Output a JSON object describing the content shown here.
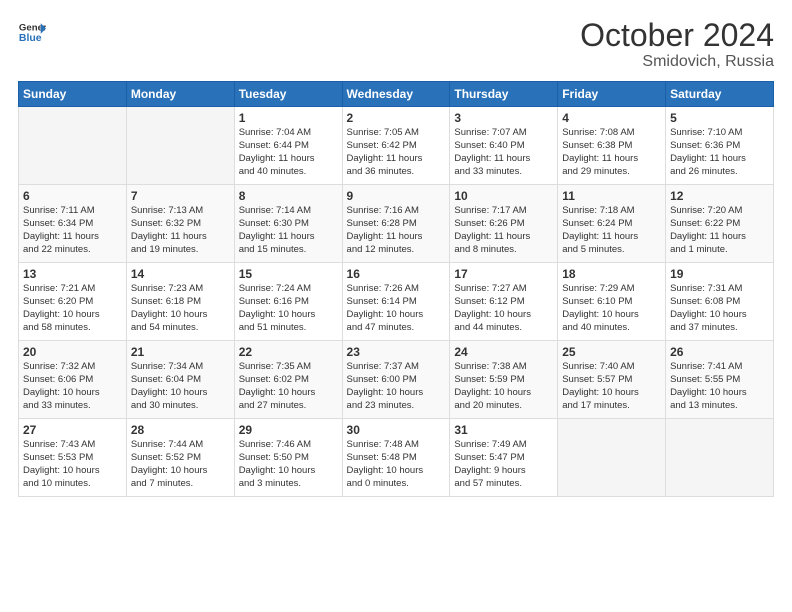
{
  "header": {
    "logo_line1": "General",
    "logo_line2": "Blue",
    "month": "October 2024",
    "location": "Smidovich, Russia"
  },
  "days": [
    "Sunday",
    "Monday",
    "Tuesday",
    "Wednesday",
    "Thursday",
    "Friday",
    "Saturday"
  ],
  "weeks": [
    [
      {
        "day": "",
        "sunrise": "",
        "sunset": "",
        "daylight": "",
        "daylight2": ""
      },
      {
        "day": "",
        "sunrise": "",
        "sunset": "",
        "daylight": "",
        "daylight2": ""
      },
      {
        "day": "1",
        "sunrise": "Sunrise: 7:04 AM",
        "sunset": "Sunset: 6:44 PM",
        "daylight": "Daylight: 11 hours",
        "daylight2": "and 40 minutes."
      },
      {
        "day": "2",
        "sunrise": "Sunrise: 7:05 AM",
        "sunset": "Sunset: 6:42 PM",
        "daylight": "Daylight: 11 hours",
        "daylight2": "and 36 minutes."
      },
      {
        "day": "3",
        "sunrise": "Sunrise: 7:07 AM",
        "sunset": "Sunset: 6:40 PM",
        "daylight": "Daylight: 11 hours",
        "daylight2": "and 33 minutes."
      },
      {
        "day": "4",
        "sunrise": "Sunrise: 7:08 AM",
        "sunset": "Sunset: 6:38 PM",
        "daylight": "Daylight: 11 hours",
        "daylight2": "and 29 minutes."
      },
      {
        "day": "5",
        "sunrise": "Sunrise: 7:10 AM",
        "sunset": "Sunset: 6:36 PM",
        "daylight": "Daylight: 11 hours",
        "daylight2": "and 26 minutes."
      }
    ],
    [
      {
        "day": "6",
        "sunrise": "Sunrise: 7:11 AM",
        "sunset": "Sunset: 6:34 PM",
        "daylight": "Daylight: 11 hours",
        "daylight2": "and 22 minutes."
      },
      {
        "day": "7",
        "sunrise": "Sunrise: 7:13 AM",
        "sunset": "Sunset: 6:32 PM",
        "daylight": "Daylight: 11 hours",
        "daylight2": "and 19 minutes."
      },
      {
        "day": "8",
        "sunrise": "Sunrise: 7:14 AM",
        "sunset": "Sunset: 6:30 PM",
        "daylight": "Daylight: 11 hours",
        "daylight2": "and 15 minutes."
      },
      {
        "day": "9",
        "sunrise": "Sunrise: 7:16 AM",
        "sunset": "Sunset: 6:28 PM",
        "daylight": "Daylight: 11 hours",
        "daylight2": "and 12 minutes."
      },
      {
        "day": "10",
        "sunrise": "Sunrise: 7:17 AM",
        "sunset": "Sunset: 6:26 PM",
        "daylight": "Daylight: 11 hours",
        "daylight2": "and 8 minutes."
      },
      {
        "day": "11",
        "sunrise": "Sunrise: 7:18 AM",
        "sunset": "Sunset: 6:24 PM",
        "daylight": "Daylight: 11 hours",
        "daylight2": "and 5 minutes."
      },
      {
        "day": "12",
        "sunrise": "Sunrise: 7:20 AM",
        "sunset": "Sunset: 6:22 PM",
        "daylight": "Daylight: 11 hours",
        "daylight2": "and 1 minute."
      }
    ],
    [
      {
        "day": "13",
        "sunrise": "Sunrise: 7:21 AM",
        "sunset": "Sunset: 6:20 PM",
        "daylight": "Daylight: 10 hours",
        "daylight2": "and 58 minutes."
      },
      {
        "day": "14",
        "sunrise": "Sunrise: 7:23 AM",
        "sunset": "Sunset: 6:18 PM",
        "daylight": "Daylight: 10 hours",
        "daylight2": "and 54 minutes."
      },
      {
        "day": "15",
        "sunrise": "Sunrise: 7:24 AM",
        "sunset": "Sunset: 6:16 PM",
        "daylight": "Daylight: 10 hours",
        "daylight2": "and 51 minutes."
      },
      {
        "day": "16",
        "sunrise": "Sunrise: 7:26 AM",
        "sunset": "Sunset: 6:14 PM",
        "daylight": "Daylight: 10 hours",
        "daylight2": "and 47 minutes."
      },
      {
        "day": "17",
        "sunrise": "Sunrise: 7:27 AM",
        "sunset": "Sunset: 6:12 PM",
        "daylight": "Daylight: 10 hours",
        "daylight2": "and 44 minutes."
      },
      {
        "day": "18",
        "sunrise": "Sunrise: 7:29 AM",
        "sunset": "Sunset: 6:10 PM",
        "daylight": "Daylight: 10 hours",
        "daylight2": "and 40 minutes."
      },
      {
        "day": "19",
        "sunrise": "Sunrise: 7:31 AM",
        "sunset": "Sunset: 6:08 PM",
        "daylight": "Daylight: 10 hours",
        "daylight2": "and 37 minutes."
      }
    ],
    [
      {
        "day": "20",
        "sunrise": "Sunrise: 7:32 AM",
        "sunset": "Sunset: 6:06 PM",
        "daylight": "Daylight: 10 hours",
        "daylight2": "and 33 minutes."
      },
      {
        "day": "21",
        "sunrise": "Sunrise: 7:34 AM",
        "sunset": "Sunset: 6:04 PM",
        "daylight": "Daylight: 10 hours",
        "daylight2": "and 30 minutes."
      },
      {
        "day": "22",
        "sunrise": "Sunrise: 7:35 AM",
        "sunset": "Sunset: 6:02 PM",
        "daylight": "Daylight: 10 hours",
        "daylight2": "and 27 minutes."
      },
      {
        "day": "23",
        "sunrise": "Sunrise: 7:37 AM",
        "sunset": "Sunset: 6:00 PM",
        "daylight": "Daylight: 10 hours",
        "daylight2": "and 23 minutes."
      },
      {
        "day": "24",
        "sunrise": "Sunrise: 7:38 AM",
        "sunset": "Sunset: 5:59 PM",
        "daylight": "Daylight: 10 hours",
        "daylight2": "and 20 minutes."
      },
      {
        "day": "25",
        "sunrise": "Sunrise: 7:40 AM",
        "sunset": "Sunset: 5:57 PM",
        "daylight": "Daylight: 10 hours",
        "daylight2": "and 17 minutes."
      },
      {
        "day": "26",
        "sunrise": "Sunrise: 7:41 AM",
        "sunset": "Sunset: 5:55 PM",
        "daylight": "Daylight: 10 hours",
        "daylight2": "and 13 minutes."
      }
    ],
    [
      {
        "day": "27",
        "sunrise": "Sunrise: 7:43 AM",
        "sunset": "Sunset: 5:53 PM",
        "daylight": "Daylight: 10 hours",
        "daylight2": "and 10 minutes."
      },
      {
        "day": "28",
        "sunrise": "Sunrise: 7:44 AM",
        "sunset": "Sunset: 5:52 PM",
        "daylight": "Daylight: 10 hours",
        "daylight2": "and 7 minutes."
      },
      {
        "day": "29",
        "sunrise": "Sunrise: 7:46 AM",
        "sunset": "Sunset: 5:50 PM",
        "daylight": "Daylight: 10 hours",
        "daylight2": "and 3 minutes."
      },
      {
        "day": "30",
        "sunrise": "Sunrise: 7:48 AM",
        "sunset": "Sunset: 5:48 PM",
        "daylight": "Daylight: 10 hours",
        "daylight2": "and 0 minutes."
      },
      {
        "day": "31",
        "sunrise": "Sunrise: 7:49 AM",
        "sunset": "Sunset: 5:47 PM",
        "daylight": "Daylight: 9 hours",
        "daylight2": "and 57 minutes."
      },
      {
        "day": "",
        "sunrise": "",
        "sunset": "",
        "daylight": "",
        "daylight2": ""
      },
      {
        "day": "",
        "sunrise": "",
        "sunset": "",
        "daylight": "",
        "daylight2": ""
      }
    ]
  ]
}
